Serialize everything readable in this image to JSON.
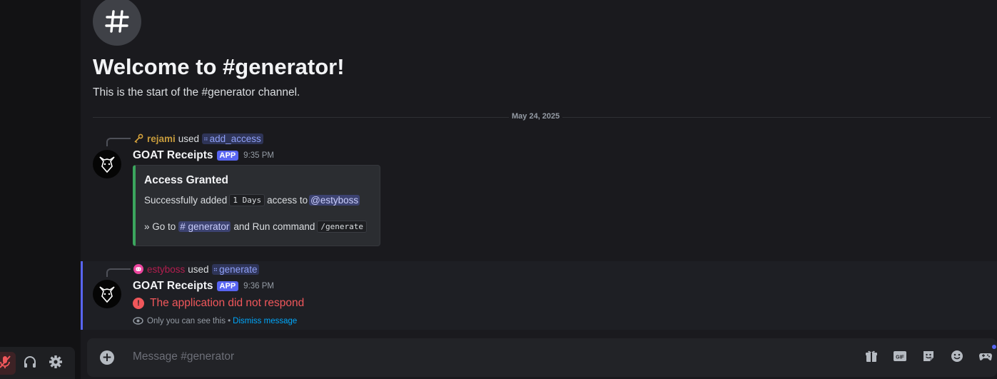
{
  "channel": {
    "welcome_title": "Welcome to #generator!",
    "welcome_subtitle": "This is the start of the #generator channel.",
    "date_divider": "May 24, 2025"
  },
  "messages": [
    {
      "reply_user": "rejami",
      "reply_user_color": "#c69b3c",
      "reply_used": "used",
      "command": "add_access",
      "author": "GOAT Receipts",
      "badge": "APP",
      "time": "9:35 PM",
      "embed": {
        "title": "Access Granted",
        "line1_prefix": "Successfully added",
        "line1_code": "1 Days",
        "line1_mid": "access to",
        "line1_mention": "@estyboss",
        "line2_prefix": "» Go to",
        "line2_channel": "# generator",
        "line2_mid": "and Run command",
        "line2_code": "/generate",
        "accent_color": "#3ba55d"
      }
    },
    {
      "reply_user": "estyboss",
      "reply_user_color": "#b51d4f",
      "reply_used": "used",
      "command": "generate",
      "author": "GOAT Receipts",
      "badge": "APP",
      "time": "9:36 PM",
      "error_text": "The application did not respond",
      "ephemeral_text": "Only you can see this •",
      "dismiss_label": "Dismiss message"
    }
  ],
  "composer": {
    "placeholder": "Message #generator"
  },
  "icons": {
    "channel": "hash-icon",
    "mute": "mic-muted-icon",
    "deafen": "headphones-icon",
    "settings": "gear-icon",
    "gift": "gift-icon",
    "gif": "gif-icon",
    "sticker": "sticker-icon",
    "emoji": "emoji-icon",
    "apps": "gamepad-icon"
  },
  "colors": {
    "accent": "#5865f2",
    "error": "#f0575b",
    "link": "#00a8fc"
  }
}
